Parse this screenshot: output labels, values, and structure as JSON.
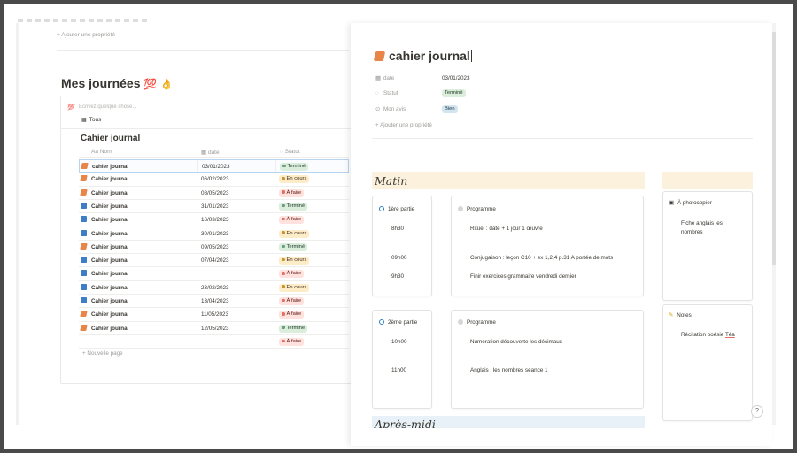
{
  "left": {
    "add_property": "+ Ajouter une propriété",
    "db_title": "Mes journées",
    "db_title_emoji": "💯 👌",
    "write_icon": "💯",
    "write_placeholder": "Écrivez quelque chose...",
    "tab_label": "Tous",
    "table_title": "Cahier journal",
    "headers": {
      "name": "Aa Nom",
      "date": "date",
      "status": "Statut"
    },
    "rows": [
      {
        "name": "cahier journal",
        "date": "03/01/2023",
        "status": "Terminé",
        "color": "green",
        "icon": "orange"
      },
      {
        "name": "Cahier journal",
        "date": "06/02/2023",
        "status": "En cours",
        "color": "yellow",
        "icon": "orange"
      },
      {
        "name": "Cahier journal",
        "date": "08/05/2023",
        "status": "À faire",
        "color": "red",
        "icon": "orange"
      },
      {
        "name": "Cahier journal",
        "date": "31/01/2023",
        "status": "Terminé",
        "color": "green",
        "icon": "blue"
      },
      {
        "name": "Cahier journal",
        "date": "16/03/2023",
        "status": "À faire",
        "color": "red",
        "icon": "blue"
      },
      {
        "name": "Cahier journal",
        "date": "30/01/2023",
        "status": "En cours",
        "color": "yellow",
        "icon": "blue"
      },
      {
        "name": "Cahier journal",
        "date": "09/05/2023",
        "status": "Terminé",
        "color": "green",
        "icon": "orange"
      },
      {
        "name": "Cahier journal",
        "date": "07/04/2023",
        "status": "En cours",
        "color": "yellow",
        "icon": "blue"
      },
      {
        "name": "Cahier journal",
        "date": "",
        "status": "À faire",
        "color": "red",
        "icon": "blue"
      },
      {
        "name": "Cahier journal",
        "date": "23/02/2023",
        "status": "En cours",
        "color": "yellow",
        "icon": "blue"
      },
      {
        "name": "Cahier journal",
        "date": "13/04/2023",
        "status": "À faire",
        "color": "red",
        "icon": "blue"
      },
      {
        "name": "Cahier journal",
        "date": "11/05/2023",
        "status": "À faire",
        "color": "red",
        "icon": "orange"
      },
      {
        "name": "Cahier journal",
        "date": "12/05/2023",
        "status": "Terminé",
        "color": "green",
        "icon": "orange"
      },
      {
        "name": "",
        "date": "",
        "status": "À faire",
        "color": "red",
        "icon": ""
      }
    ],
    "new_page": "+ Nouvelle page"
  },
  "right": {
    "title": "cahier journal",
    "props": [
      {
        "icon": "calendar-icon",
        "glyph": "▦",
        "label": "date",
        "value": "03/01/2023",
        "kind": "text"
      },
      {
        "icon": "status-icon",
        "glyph": "◌",
        "label": "Statut",
        "value": "Terminé",
        "kind": "green"
      },
      {
        "icon": "select-icon",
        "glyph": "⊙",
        "label": "Mon avis",
        "value": "Bien",
        "kind": "blue"
      }
    ],
    "add_property": "+ Ajouter une propriété",
    "matin_label": "Matin",
    "aprem_label": "Après-midi",
    "part1_label": "1ère partie",
    "part1_times": [
      "8h30",
      "09h00",
      "9h30"
    ],
    "programme_label": "Programme",
    "prog1_lines": [
      "Rituel : date + 1 jour 1 œuvre",
      "Conjugaison : leçon C10 + ex 1,2,4 p.31 A portée de mots",
      "Finir exercices grammaire vendredi dernier"
    ],
    "photocopier_label": "À photocopier",
    "photocopier_text": [
      "Fiche anglais les",
      "nombres"
    ],
    "part2_label": "2ème partie",
    "part2_times": [
      "10h00",
      "11h00"
    ],
    "prog2_lines": [
      "Numération découverte les décimaux",
      "Anglais : les nombres séance 1"
    ],
    "notes_label": "Notes",
    "notes_text": "Récitation poésie",
    "notes_name": "Téa",
    "help": "?"
  },
  "colors": {
    "green": "#dbeddb",
    "yellow": "#fdecc8",
    "red": "#ffe2dd",
    "accent": "#2f80c5"
  }
}
